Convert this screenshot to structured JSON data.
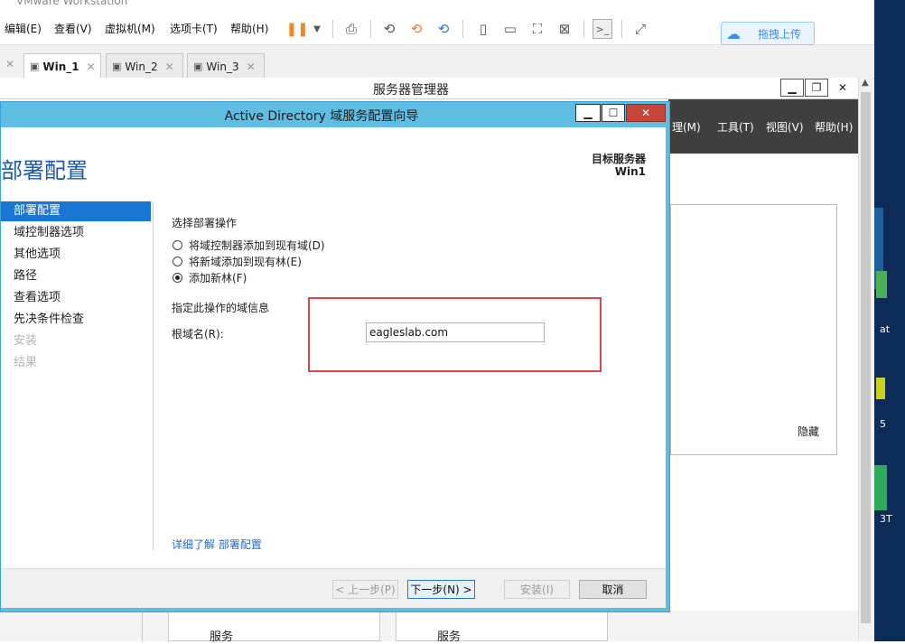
{
  "vmware": {
    "title": "VMware Workstation",
    "menu": [
      {
        "label": "编辑(E)"
      },
      {
        "label": "查看(V)"
      },
      {
        "label": "虚拟机(M)"
      },
      {
        "label": "选项卡(T)"
      },
      {
        "label": "帮助(H)"
      }
    ],
    "upload_label": "拖拽上传",
    "tabs": [
      {
        "label": "Win_1",
        "active": true
      },
      {
        "label": "Win_2",
        "active": false
      },
      {
        "label": "Win_3",
        "active": false
      }
    ]
  },
  "server_manager": {
    "title": "服务器管理器",
    "menu": [
      {
        "label": "理(M)"
      },
      {
        "label": "工具(T)"
      },
      {
        "label": "视图(V)"
      },
      {
        "label": "帮助(H)"
      }
    ],
    "panel_hide_label": "隐藏",
    "tile_label": "服务"
  },
  "wizard": {
    "title": "Active Directory 域服务配置向导",
    "heading": "部署配置",
    "target_label": "目标服务器",
    "target_value": "Win1",
    "nav": [
      {
        "label": "部署配置",
        "state": "active"
      },
      {
        "label": "域控制器选项",
        "state": "normal"
      },
      {
        "label": "其他选项",
        "state": "normal"
      },
      {
        "label": "路径",
        "state": "normal"
      },
      {
        "label": "查看选项",
        "state": "normal"
      },
      {
        "label": "先决条件检查",
        "state": "normal"
      },
      {
        "label": "安装",
        "state": "disabled"
      },
      {
        "label": "结果",
        "state": "disabled"
      }
    ],
    "operation_section": "选择部署操作",
    "options": [
      {
        "label": "将域控制器添加到现有域(D)",
        "selected": false
      },
      {
        "label": "将新域添加到现有林(E)",
        "selected": false
      },
      {
        "label": "添加新林(F)",
        "selected": true
      }
    ],
    "domain_info_section": "指定此操作的域信息",
    "root_domain_label": "根域名(R):",
    "root_domain_value": "eagleslab.com",
    "more_link": "详细了解 部署配置",
    "buttons": {
      "prev": "< 上一步(P)",
      "next": "下一步(N) >",
      "install": "安装(I)",
      "cancel": "取消"
    }
  },
  "desktop": {
    "labels": [
      "at",
      "5",
      "3T"
    ]
  },
  "colors": {
    "wizard_frame": "#60bde2",
    "nav_active": "#1976d2",
    "heading": "#1e5aa6",
    "highlight_box": "#e04545",
    "link": "#1e6ccf"
  }
}
